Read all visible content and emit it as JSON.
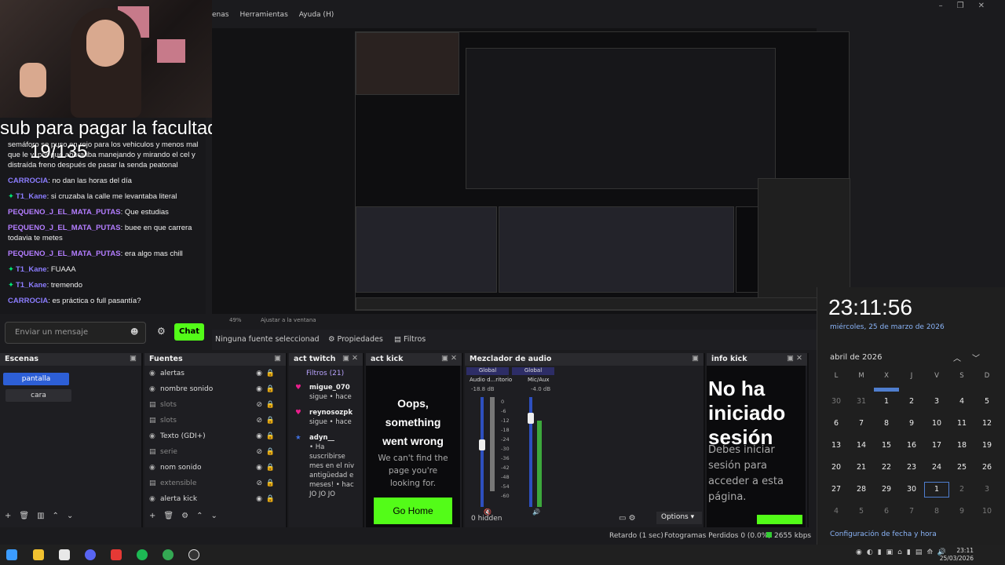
{
  "menu": {
    "items": [
      "enas",
      "Herramientas",
      "Ayuda (H)"
    ]
  },
  "overlay": {
    "text": "sub para pagar la facultad",
    "count": "19/135"
  },
  "chat": {
    "messages": [
      {
        "user": "",
        "text": "semáforo se puso en rojo para los vehiculos y menos mal que le vi por que ahora iba manejando y mirando el cel y distraída freno después de pasar la senda peatonal",
        "color": "#ffffff",
        "gem": false
      },
      {
        "user": "CARROCIA",
        "text": "no dan las horas del día",
        "color": "#8c7dff",
        "gem": false
      },
      {
        "user": "T1_Kane",
        "text": "si cruzaba la calle me levantaba literal",
        "color": "#8c7dff",
        "gem": true
      },
      {
        "user": "PEQUENO_J_EL_MATA_PUTAS",
        "text": "Que estudias",
        "color": "#b37dff",
        "gem": false
      },
      {
        "user": "PEQUENO_J_EL_MATA_PUTAS",
        "text": "buee en que carrera todavia te metes",
        "color": "#b37dff",
        "gem": false
      },
      {
        "user": "PEQUENO_J_EL_MATA_PUTAS",
        "text": "era algo mas chill",
        "color": "#b37dff",
        "gem": false
      },
      {
        "user": "T1_Kane",
        "text": "FUAAA",
        "color": "#8c7dff",
        "gem": true
      },
      {
        "user": "T1_Kane",
        "text": "tremendo",
        "color": "#8c7dff",
        "gem": true
      },
      {
        "user": "CARROCIA",
        "text": "es práctica o full pasantía?",
        "color": "#8c7dff",
        "gem": false
      }
    ],
    "input_placeholder": "Enviar un mensaje",
    "send_label": "Chat"
  },
  "tools": {
    "zoom": "49%",
    "fit": "Ajustar a la ventana"
  },
  "source_status": {
    "none_selected": "Ninguna fuente seleccionad",
    "properties": "Propiedades",
    "filters": "Filtros"
  },
  "scenes": {
    "title": "Escenas",
    "items": [
      "pantalla",
      "cara"
    ]
  },
  "sources": {
    "title": "Fuentes",
    "items": [
      {
        "name": "alertas",
        "visible": true
      },
      {
        "name": "nombre sonido",
        "visible": true
      },
      {
        "name": "slots",
        "visible": false
      },
      {
        "name": "slots",
        "visible": false
      },
      {
        "name": "Texto (GDI+)",
        "visible": true
      },
      {
        "name": "serie",
        "visible": false
      },
      {
        "name": "nom sonido",
        "visible": true
      },
      {
        "name": "extensible",
        "visible": false
      },
      {
        "name": "alerta kick",
        "visible": true
      }
    ]
  },
  "act_twitch": {
    "title": "act  twitch",
    "filters": "Filtros (21)",
    "events": [
      {
        "user": "migue_070",
        "text": "sigue • hace",
        "icon_color": "#e91e8c"
      },
      {
        "user": "reynosozpk",
        "text": "sigue • hace",
        "icon_color": "#e91e8c"
      },
      {
        "user": "adyn__",
        "text": "• Ha suscribirse mes en el niv antigüedad e meses! • hac JO JO JO",
        "icon_color": "#3f6fe0"
      }
    ]
  },
  "act_kick": {
    "title": "act kick",
    "heading": "Oops, something went wrong",
    "body": "We can't find the page you're looking for.",
    "button": "Go Home"
  },
  "mixer": {
    "title": "Mezclador de audio",
    "channels": [
      {
        "label": "Global",
        "name": "Audio d...ritorio",
        "db": "-18.8 dB"
      },
      {
        "label": "Global",
        "name": "Mic/Aux",
        "db": "-4.0 dB"
      }
    ],
    "scale": [
      "0",
      "-6",
      "-12",
      "-18",
      "-24",
      "-30",
      "-36",
      "-42",
      "-48",
      "-54",
      "-60"
    ],
    "hidden": "0 hidden",
    "options": "Options"
  },
  "info_kick": {
    "title": "info kick",
    "heading": "No ha iniciado sesión",
    "body": "Debes iniciar sesión para acceder a esta página."
  },
  "status": {
    "delay": "Retardo (1 sec)",
    "frames": "Fotogramas Perdidos 0 (0.0%)",
    "kbps": "2655 kbps"
  },
  "clock": {
    "time": "23:11:56",
    "date": "miércoles, 25 de marzo de 2026",
    "month": "abril de 2026",
    "weekdays": [
      "L",
      "M",
      "X",
      "J",
      "V",
      "S",
      "D"
    ],
    "rows": [
      [
        "30",
        "31",
        "1",
        "2",
        "3",
        "4",
        "5"
      ],
      [
        "6",
        "7",
        "8",
        "9",
        "10",
        "11",
        "12"
      ],
      [
        "13",
        "14",
        "15",
        "16",
        "17",
        "18",
        "19"
      ],
      [
        "20",
        "21",
        "22",
        "23",
        "24",
        "25",
        "26"
      ],
      [
        "27",
        "28",
        "29",
        "30",
        "1",
        "2",
        "3"
      ],
      [
        "4",
        "5",
        "6",
        "7",
        "8",
        "9",
        "10"
      ]
    ],
    "footer": "Configuración de fecha y hora"
  },
  "taskbar_clock": {
    "time": "23:11",
    "date": "25/03/2026"
  }
}
